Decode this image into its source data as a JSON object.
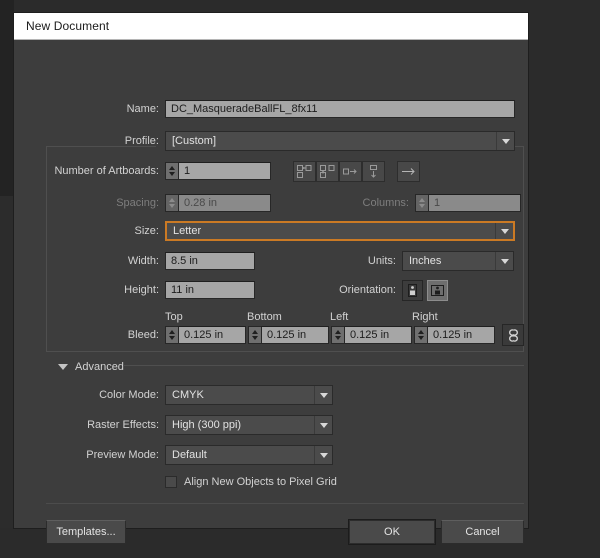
{
  "window": {
    "title": "New Document"
  },
  "fields": {
    "name_label": "Name:",
    "name_value": "DC_MasqueradeBallFL_8fx11",
    "profile_label": "Profile:",
    "profile_value": "[Custom]",
    "artboards_label": "Number of Artboards:",
    "artboards_value": "1",
    "spacing_label": "Spacing:",
    "spacing_value": "0.28 in",
    "columns_label": "Columns:",
    "columns_value": "1",
    "size_label": "Size:",
    "size_value": "Letter",
    "width_label": "Width:",
    "width_value": "8.5 in",
    "height_label": "Height:",
    "height_value": "11 in",
    "units_label": "Units:",
    "units_value": "Inches",
    "orientation_label": "Orientation:"
  },
  "artboard_arrangement": {
    "buttons": [
      {
        "name": "grid-by-row-icon"
      },
      {
        "name": "grid-by-column-icon"
      },
      {
        "name": "arrange-by-row-icon"
      },
      {
        "name": "arrange-by-column-icon"
      }
    ],
    "direction_button": {
      "name": "change-to-right-to-left-layout-icon"
    }
  },
  "orientation": {
    "portrait": {
      "name": "portrait-icon",
      "selected": false
    },
    "landscape": {
      "name": "landscape-icon",
      "selected": true
    }
  },
  "bleed": {
    "label": "Bleed:",
    "top_label": "Top",
    "bottom_label": "Bottom",
    "left_label": "Left",
    "right_label": "Right",
    "top_value": "0.125 in",
    "bottom_value": "0.125 in",
    "left_value": "0.125 in",
    "right_value": "0.125 in",
    "link_icon": "link-chain-icon"
  },
  "advanced": {
    "label": "Advanced",
    "expanded": true,
    "color_mode_label": "Color Mode:",
    "color_mode_value": "CMYK",
    "raster_effects_label": "Raster Effects:",
    "raster_effects_value": "High (300 ppi)",
    "preview_mode_label": "Preview Mode:",
    "preview_mode_value": "Default",
    "align_pixel_grid_label": "Align New Objects to Pixel Grid",
    "align_pixel_grid_checked": false
  },
  "footer": {
    "templates_label": "Templates...",
    "ok_label": "OK",
    "cancel_label": "Cancel"
  },
  "colors": {
    "dialog_bg": "#3d3d3d",
    "titlebar_bg": "#ffffff",
    "field_bg": "#a6a6a6",
    "combo_bg": "#4b4b4b",
    "focus_accent": "#cb7a24",
    "label_text": "#d2d2d2",
    "disabled_text": "#7e7e7e"
  }
}
